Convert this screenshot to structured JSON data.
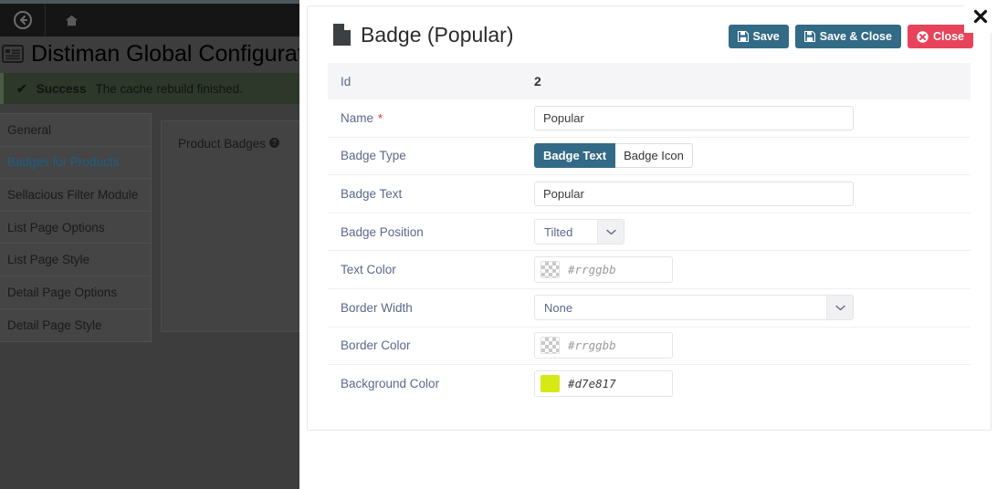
{
  "background_page": {
    "nav": {
      "back_icon": "back-arrow-icon",
      "home_icon": "home-icon"
    },
    "close_label": "✖",
    "title": "Distiman Global Configuration",
    "title_icon": "list-icon",
    "alert": {
      "check": "✔",
      "label": "Success",
      "message": "The cache rebuild finished."
    },
    "sidebar": {
      "items": [
        {
          "label": "General",
          "active": false
        },
        {
          "label": "Badges for Products",
          "active": true
        },
        {
          "label": "Sellacious Filter Module",
          "active": false
        },
        {
          "label": "List Page Options",
          "active": false
        },
        {
          "label": "List Page Style",
          "active": false
        },
        {
          "label": "Detail Page Options",
          "active": false
        },
        {
          "label": "Detail Page Style",
          "active": false
        }
      ]
    },
    "panel": {
      "heading": "Product Badges",
      "help_glyph": "?"
    }
  },
  "modal": {
    "title": "Badge (Popular)",
    "title_icon": "document-icon",
    "buttons": {
      "save": "Save",
      "save_close": "Save & Close",
      "close": "Close",
      "save_icon": "floppy-disk-icon",
      "close_icon": "x-circle-icon"
    },
    "colors": {
      "primary": "#336a85",
      "danger": "#e7445c",
      "label": "#5d678c",
      "required": "#e8262f"
    },
    "form": {
      "id": {
        "label": "Id",
        "value": "2"
      },
      "name": {
        "label": "Name",
        "required": "*",
        "value": "Popular",
        "placeholder": ""
      },
      "badge_type": {
        "label": "Badge Type",
        "options": [
          "Badge Text",
          "Badge Icon"
        ],
        "selected": "Badge Text"
      },
      "badge_text": {
        "label": "Badge Text",
        "value": "Popular",
        "placeholder": ""
      },
      "badge_position": {
        "label": "Badge Position",
        "selected": "Tilted",
        "chevron": "chevron-down-icon"
      },
      "text_color": {
        "label": "Text Color",
        "value": "",
        "placeholder": "#rrggbb",
        "swatch": "transparent"
      },
      "border_width": {
        "label": "Border Width",
        "selected": "None",
        "chevron": "chevron-down-icon"
      },
      "border_color": {
        "label": "Border Color",
        "value": "",
        "placeholder": "#rrggbb",
        "swatch": "transparent"
      },
      "background_color": {
        "label": "Background Color",
        "value": "#d7e817",
        "placeholder": "#rrggbb",
        "swatch": "#d7e817"
      }
    }
  }
}
